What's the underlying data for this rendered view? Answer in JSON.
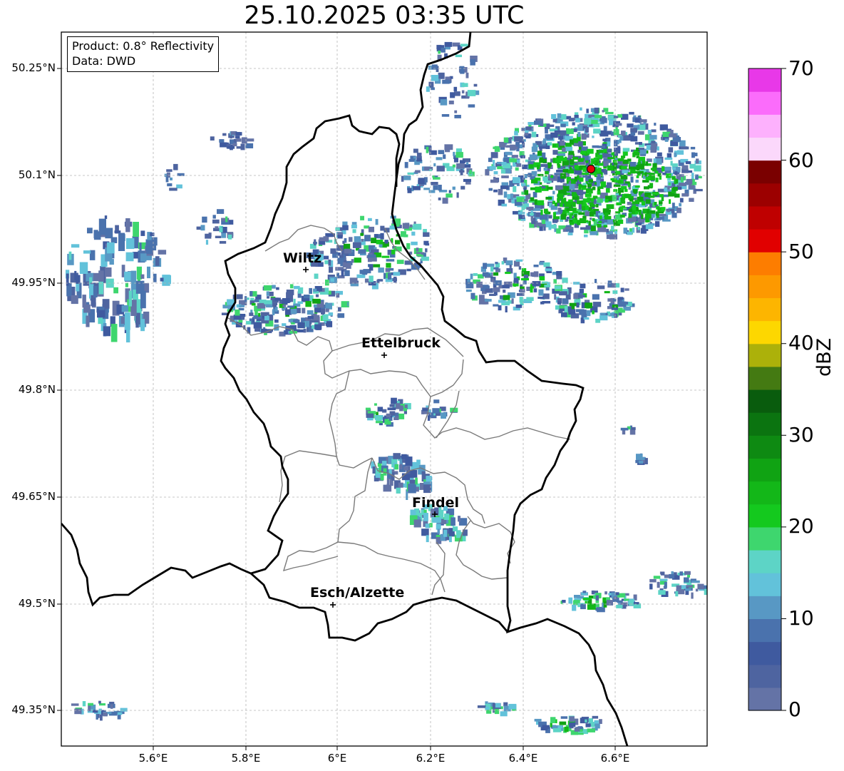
{
  "title": "25.10.2025 03:35 UTC",
  "info": {
    "product": "Product: 0.8° Reflectivity",
    "data": "Data: DWD"
  },
  "lat_labels": [
    "50.25°N",
    "50.1°N",
    "49.95°N",
    "49.8°N",
    "49.65°N",
    "49.5°N",
    "49.35°N"
  ],
  "lon_labels": [
    "5.6°E",
    "5.8°E",
    "6°E",
    "6.2°E",
    "6.4°E",
    "6.6°E"
  ],
  "cities": [
    {
      "name": "Wiltz"
    },
    {
      "name": "Ettelbruck"
    },
    {
      "name": "Findel"
    },
    {
      "name": "Esch/Alzette"
    }
  ],
  "colorbar": {
    "label": "dBZ",
    "ticks": [
      "70",
      "60",
      "50",
      "40",
      "30",
      "20",
      "10",
      "0"
    ],
    "min": 0,
    "max": 70,
    "step": 2.5,
    "colors": [
      "#6473a6",
      "#4e64a0",
      "#3f5a9f",
      "#4a72ad",
      "#5898c4",
      "#62c2da",
      "#5dd4c6",
      "#3ed66e",
      "#14c91e",
      "#13b718",
      "#10a313",
      "#0e8a12",
      "#0b7410",
      "#095c0d",
      "#447a12",
      "#acb10a",
      "#fdd700",
      "#fdb500",
      "#fd9900",
      "#fd7d00",
      "#e10000",
      "#bf0000",
      "#9c0000",
      "#7a0000",
      "#fbd8fb",
      "#fdb1fd",
      "#fb6cfb",
      "#e838e8"
    ]
  },
  "radar_site": {
    "color": "#e8000a"
  },
  "colors": {
    "border": "#000000",
    "district": "#7a7a7a",
    "grid": "#b5b5b5"
  }
}
